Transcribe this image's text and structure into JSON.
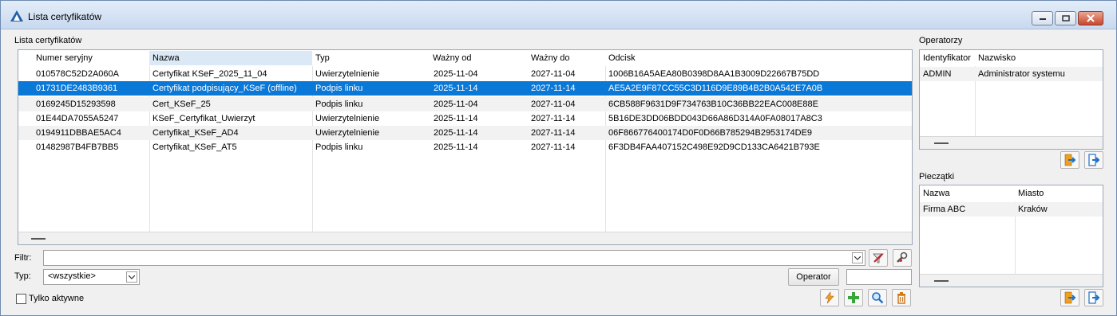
{
  "window": {
    "title": "Lista certyfikatów"
  },
  "certs": {
    "label": "Lista certyfikatów",
    "columns": [
      "Numer seryjny",
      "Nazwa",
      "Typ",
      "Ważny od",
      "Ważny do",
      "Odcisk"
    ],
    "rows": [
      {
        "serial": "010578C52D2A060A",
        "name": "Certyfikat KSeF_2025_11_04",
        "type": "Uwierzytelnienie",
        "from": "2025-11-04",
        "to": "2027-11-04",
        "thumb": "1006B16A5AEA80B0398D8AA1B3009D22667B75DD"
      },
      {
        "serial": "01731DE2483B9361",
        "name": "Certyfikat podpisujący_KSeF (offline)",
        "type": "Podpis linku",
        "from": "2025-11-14",
        "to": "2027-11-14",
        "thumb": "AE5A2E9F87CC55C3D116D9E89B4B2B0A542E7A0B"
      },
      {
        "serial": "0169245D15293598",
        "name": "Cert_KSeF_25",
        "type": "Podpis linku",
        "from": "2025-11-04",
        "to": "2027-11-04",
        "thumb": "6CB588F9631D9F734763B10C36BB22EAC008E88E"
      },
      {
        "serial": "01E44DA7055A5247",
        "name": "KSeF_Certyfikat_Uwierzyt",
        "type": "Uwierzytelnienie",
        "from": "2025-11-14",
        "to": "2027-11-14",
        "thumb": "5B16DE3DD06BDD043D66A86D314A0FA08017A8C3"
      },
      {
        "serial": "0194911DBBAE5AC4",
        "name": "Certyfikat_KSeF_AD4",
        "type": "Uwierzytelnienie",
        "from": "2025-11-14",
        "to": "2027-11-14",
        "thumb": "06F866776400174D0F0D66B785294B2953174DE9"
      },
      {
        "serial": "01482987B4FB7BB5",
        "name": "Certyfikat_KSeF_AT5",
        "type": "Podpis linku",
        "from": "2025-11-14",
        "to": "2027-11-14",
        "thumb": "6F3DB4FAA407152C498E92D9CD133CA6421B793E"
      }
    ]
  },
  "filter": {
    "label": "Filtr:",
    "value": ""
  },
  "type_filter": {
    "label": "Typ:",
    "value": "<wszystkie>"
  },
  "active_only": {
    "label": "Tylko aktywne",
    "checked": false
  },
  "operator_button": "Operator",
  "operators": {
    "label": "Operatorzy",
    "columns": [
      "Identyfikator",
      "Nazwisko"
    ],
    "rows": [
      {
        "id": "ADMIN",
        "name": "Administrator systemu"
      }
    ]
  },
  "stamps": {
    "label": "Pieczątki",
    "columns": [
      "Nazwa",
      "Miasto"
    ],
    "rows": [
      {
        "name": "Firma ABC",
        "city": "Kraków"
      }
    ]
  },
  "colors": {
    "selection": "#0a78d7",
    "accent_blue": "#1f6fc5",
    "add_green": "#3aa53a",
    "delete_orange": "#d07a1a"
  }
}
